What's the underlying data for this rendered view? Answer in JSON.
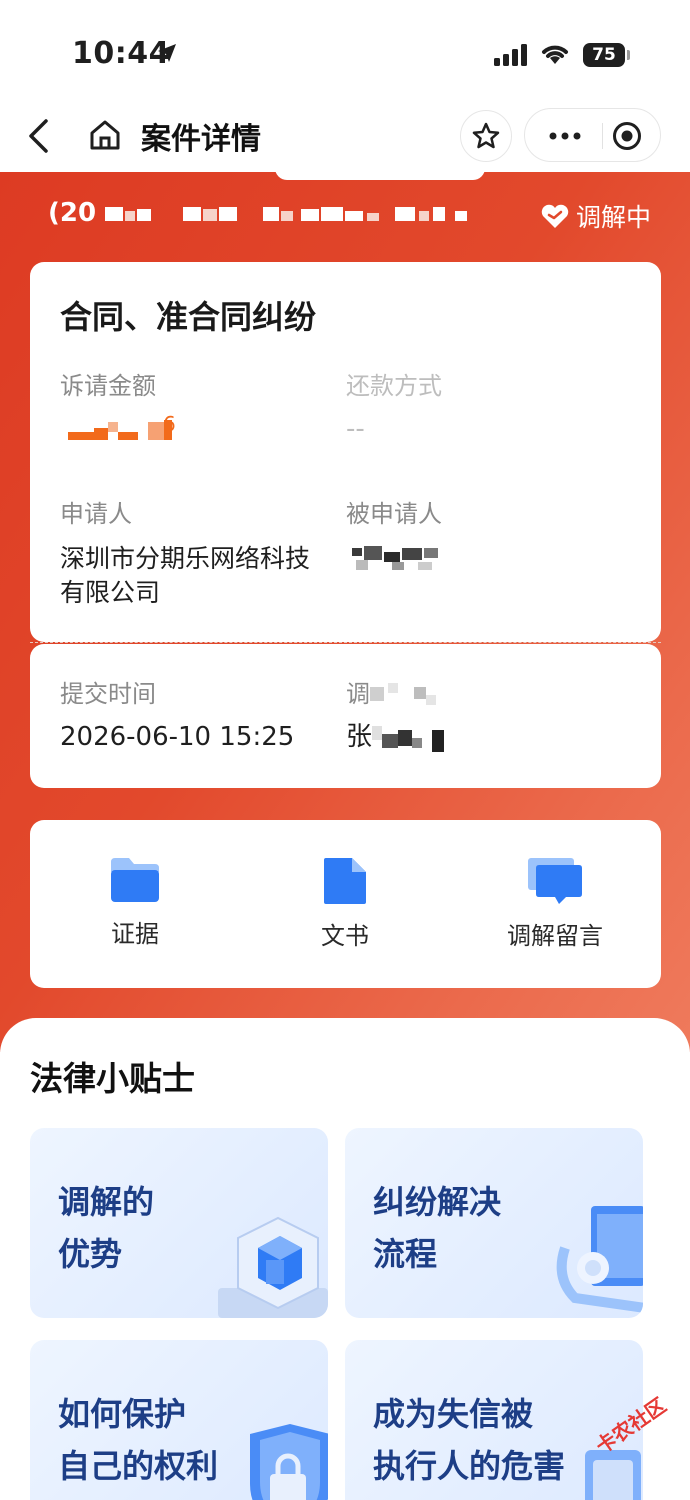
{
  "status_bar": {
    "time": "10:44",
    "battery": "75",
    "icons": [
      "location-arrow-icon",
      "signal-icon",
      "wifi-icon",
      "battery-icon"
    ]
  },
  "nav": {
    "title": "案件详情",
    "icons": [
      "back-icon",
      "home-icon",
      "star-icon",
      "more-icon",
      "target-icon"
    ]
  },
  "case": {
    "number_prefix": "(20",
    "status": "调解中",
    "type": "合同、准合同纠纷",
    "claim_amount_label": "诉请金额",
    "claim_amount_visible": "6",
    "repayment_label": "还款方式",
    "repayment_value": "--",
    "applicant_label": "申请人",
    "applicant_value": "深圳市分期乐网络科技有限公司",
    "respondent_label": "被申请人",
    "submit_time_label": "提交时间",
    "submit_time_value": "2026-06-10 15:25",
    "mediator_label_visible": "调",
    "mediator_value_visible": "张"
  },
  "actions": [
    {
      "label": "证据",
      "icon": "folder-icon"
    },
    {
      "label": "文书",
      "icon": "document-icon"
    },
    {
      "label": "调解留言",
      "icon": "message-icon"
    }
  ],
  "tips": {
    "title": "法律小贴士",
    "items": [
      {
        "line1": "调解的",
        "line2": "优势"
      },
      {
        "line1": "纠纷解决",
        "line2": "流程"
      },
      {
        "line1": "如何保护",
        "line2": "自己的权利"
      },
      {
        "line1": "成为失信被",
        "line2": "执行人的危害"
      }
    ]
  },
  "watermark": "卡农社区",
  "colors": {
    "header_red": "#e2492c",
    "accent_orange": "#f26a1b",
    "tip_text_blue": "#1d3e86",
    "icon_blue": "#2f7bf5"
  }
}
